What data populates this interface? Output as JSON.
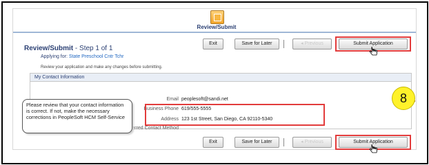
{
  "step": {
    "icon": "step-icon",
    "title": "Review/Submit"
  },
  "toolbar_top": {
    "exit": "Exit",
    "save_for_later": "Save for Later",
    "previous": "Previous",
    "submit": "Submit Application"
  },
  "page": {
    "title_main": "Review/Submit",
    "title_step": "- Step 1 of 1",
    "applying_label": "Applying for:",
    "applying_value": "State Preschool Cntr Tchr",
    "instructions": "Review your application and make any changes before submitting."
  },
  "contact": {
    "section_title": "My Contact Information",
    "fields": [
      {
        "label": "Email",
        "value": "peoplesoft@sandi.net"
      },
      {
        "label": "Business Phone",
        "value": "619/555-5555"
      },
      {
        "label": "Address",
        "value": "123 1st Street, San Diego, CA 92110-5340"
      },
      {
        "label": "Preferred Contact Method",
        "value": ""
      }
    ],
    "edit_icon": "pencil-icon"
  },
  "callout": {
    "text": "Please review that your contact information is correct. If not, make the necessary corrections in PeopleSoft HCM Self-Service"
  },
  "badge": {
    "number": "8"
  },
  "toolbar_bottom": {
    "exit": "Exit",
    "save_for_later": "Save for Later",
    "previous": "Previous",
    "submit": "Submit Application"
  },
  "colors": {
    "title": "#2a3f73",
    "highlight": "#e23b3b",
    "badge": "#fff22b"
  }
}
